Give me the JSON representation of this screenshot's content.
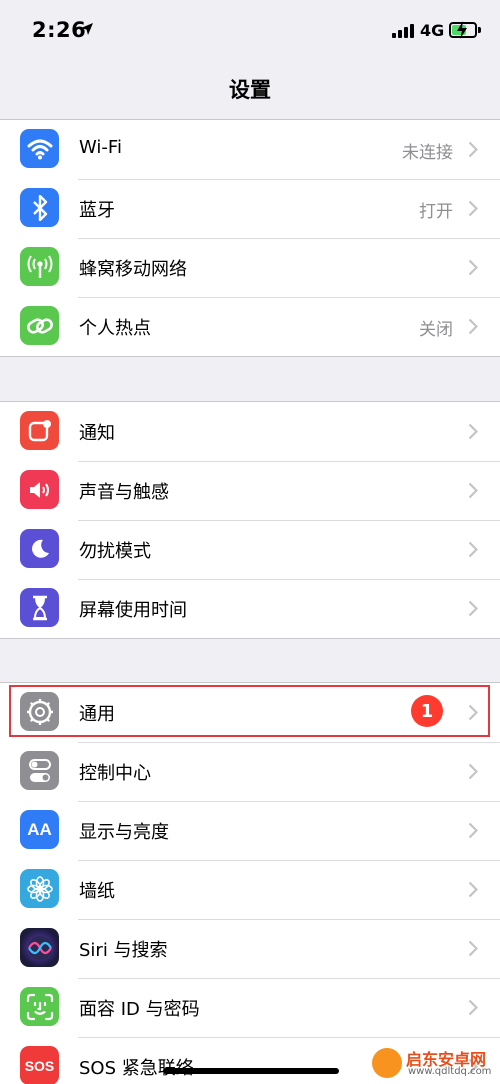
{
  "status_bar": {
    "time": "2:26",
    "network": "4G"
  },
  "nav": {
    "title": "设置"
  },
  "groups": [
    {
      "rows": [
        {
          "label": "Wi-Fi",
          "value": "未连接",
          "icon": "wifi-icon",
          "color": "#2f7cf6"
        },
        {
          "label": "蓝牙",
          "value": "打开",
          "icon": "bluetooth-icon",
          "color": "#2f7cf6"
        },
        {
          "label": "蜂窝移动网络",
          "value": "",
          "icon": "cellular-antenna-icon",
          "color": "#5ac84e"
        },
        {
          "label": "个人热点",
          "value": "关闭",
          "icon": "hotspot-link-icon",
          "color": "#5ac84e"
        }
      ]
    },
    {
      "rows": [
        {
          "label": "通知",
          "value": "",
          "icon": "notification-icon",
          "color": "#f04a3c"
        },
        {
          "label": "声音与触感",
          "value": "",
          "icon": "speaker-icon",
          "color": "#f03a55"
        },
        {
          "label": "勿扰模式",
          "value": "",
          "icon": "moon-icon",
          "color": "#5b4fd6"
        },
        {
          "label": "屏幕使用时间",
          "value": "",
          "icon": "hourglass-icon",
          "color": "#5b4fd6"
        }
      ]
    },
    {
      "rows": [
        {
          "label": "通用",
          "value": "",
          "badge": "1",
          "icon": "gear-icon",
          "color": "#8e8e93"
        },
        {
          "label": "控制中心",
          "value": "",
          "icon": "toggle-switches-icon",
          "color": "#8e8e93"
        },
        {
          "label": "显示与亮度",
          "value": "",
          "icon": "text-size-icon",
          "color": "#2f7cf6",
          "icon_text": "AA"
        },
        {
          "label": "墙纸",
          "value": "",
          "icon": "flower-icon",
          "color": "#35a8e0"
        },
        {
          "label": "Siri 与搜索",
          "value": "",
          "icon": "siri-icon",
          "color": "#1b1b3a"
        },
        {
          "label": "面容 ID 与密码",
          "value": "",
          "icon": "face-id-icon",
          "color": "#5ac84e"
        },
        {
          "label": "SOS 紧急联络",
          "value": "",
          "icon": "sos-icon",
          "color": "#f03a3a",
          "icon_text": "SOS"
        }
      ]
    }
  ],
  "watermark": {
    "name": "启东安卓网",
    "url": "www.qdltdq.com"
  }
}
